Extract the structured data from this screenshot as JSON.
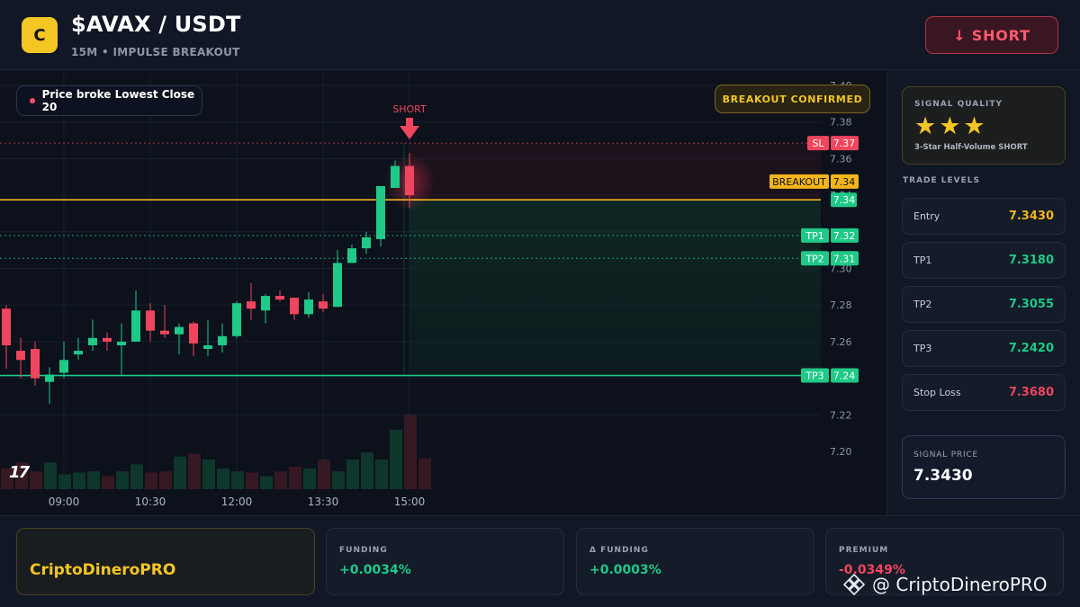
{
  "header": {
    "logo_letter": "C",
    "pair": "$AVAX / USDT",
    "subtitle": "15M • IMPULSE BREAKOUT",
    "action_button": "↓ SHORT"
  },
  "chart": {
    "price_note": "Price broke Lowest Close 20",
    "breakout_badge": "BREAKOUT CONFIRMED",
    "signal_marker": "SHORT",
    "tv_logo": "17"
  },
  "chart_data": {
    "type": "candlestick",
    "x_ticks": [
      "09:00",
      "10:30",
      "12:00",
      "13:30",
      "15:00"
    ],
    "y_ticks": [
      "7.40",
      "7.38",
      "7.36",
      "7.34",
      "7.32",
      "7.30",
      "7.28",
      "7.26",
      "7.22",
      "7.20"
    ],
    "ylim": [
      7.19,
      7.4
    ],
    "candles": [
      {
        "o": 7.278,
        "h": 7.28,
        "c": 7.258,
        "l": 7.245
      },
      {
        "o": 7.255,
        "h": 7.262,
        "c": 7.25,
        "l": 7.24
      },
      {
        "o": 7.256,
        "h": 7.26,
        "c": 7.24,
        "l": 7.236
      },
      {
        "o": 7.238,
        "h": 7.246,
        "c": 7.242,
        "l": 7.226
      },
      {
        "o": 7.243,
        "h": 7.26,
        "c": 7.25,
        "l": 7.24
      },
      {
        "o": 7.253,
        "h": 7.262,
        "c": 7.255,
        "l": 7.25
      },
      {
        "o": 7.258,
        "h": 7.272,
        "c": 7.262,
        "l": 7.255
      },
      {
        "o": 7.262,
        "h": 7.265,
        "c": 7.26,
        "l": 7.255
      },
      {
        "o": 7.258,
        "h": 7.27,
        "c": 7.26,
        "l": 7.242
      },
      {
        "o": 7.26,
        "h": 7.288,
        "c": 7.277,
        "l": 7.26
      },
      {
        "o": 7.277,
        "h": 7.281,
        "c": 7.266,
        "l": 7.26
      },
      {
        "o": 7.266,
        "h": 7.28,
        "c": 7.264,
        "l": 7.262
      },
      {
        "o": 7.264,
        "h": 7.27,
        "c": 7.268,
        "l": 7.253
      },
      {
        "o": 7.27,
        "h": 7.271,
        "c": 7.259,
        "l": 7.252
      },
      {
        "o": 7.256,
        "h": 7.272,
        "c": 7.258,
        "l": 7.252
      },
      {
        "o": 7.258,
        "h": 7.27,
        "c": 7.263,
        "l": 7.254
      },
      {
        "o": 7.263,
        "h": 7.282,
        "c": 7.281,
        "l": 7.262
      },
      {
        "o": 7.282,
        "h": 7.292,
        "c": 7.278,
        "l": 7.272
      },
      {
        "o": 7.277,
        "h": 7.286,
        "c": 7.285,
        "l": 7.27
      },
      {
        "o": 7.285,
        "h": 7.288,
        "c": 7.283,
        "l": 7.282
      },
      {
        "o": 7.284,
        "h": 7.284,
        "c": 7.275,
        "l": 7.272
      },
      {
        "o": 7.275,
        "h": 7.287,
        "c": 7.283,
        "l": 7.273
      },
      {
        "o": 7.282,
        "h": 7.286,
        "c": 7.278,
        "l": 7.276
      },
      {
        "o": 7.279,
        "h": 7.31,
        "c": 7.303,
        "l": 7.279
      },
      {
        "o": 7.303,
        "h": 7.313,
        "c": 7.311,
        "l": 7.303
      },
      {
        "o": 7.311,
        "h": 7.32,
        "c": 7.317,
        "l": 7.308
      },
      {
        "o": 7.316,
        "h": 7.337,
        "c": 7.345,
        "l": 7.312
      },
      {
        "o": 7.344,
        "h": 7.359,
        "c": 7.356,
        "l": 7.344
      },
      {
        "o": 7.356,
        "h": 7.363,
        "c": 7.34,
        "l": 7.333
      }
    ],
    "volume": [
      0.35,
      0.45,
      0.3,
      0.45,
      0.25,
      0.28,
      0.3,
      0.22,
      0.3,
      0.42,
      0.28,
      0.3,
      0.55,
      0.6,
      0.5,
      0.35,
      0.3,
      0.28,
      0.22,
      0.3,
      0.38,
      0.35,
      0.5,
      0.3,
      0.5,
      0.62,
      0.5,
      1.0,
      1.25,
      0.52
    ],
    "levels": [
      {
        "label": "SL",
        "value": "7.37",
        "color": "#f0455e"
      },
      {
        "label": "BREAKOUT",
        "value": "7.34",
        "color": "#f3b51d"
      },
      {
        "label": "TP1",
        "value": "7.32",
        "color": "#1fc987"
      },
      {
        "label": "TP2",
        "value": "7.31",
        "color": "#1fc987"
      },
      {
        "label": "TP3",
        "value": "7.24",
        "color": "#1fc987"
      }
    ],
    "current_price_tag": "7.34"
  },
  "panel": {
    "quality_label": "SIGNAL QUALITY",
    "stars": "★★★",
    "quality_desc": "3-Star Half-Volume SHORT",
    "levels_label": "TRADE LEVELS",
    "levels": [
      {
        "name": "Entry",
        "value": "7.3430",
        "color": "#f3b51d"
      },
      {
        "name": "TP1",
        "value": "7.3180",
        "color": "#1fc987"
      },
      {
        "name": "TP2",
        "value": "7.3055",
        "color": "#1fc987"
      },
      {
        "name": "TP3",
        "value": "7.2420",
        "color": "#1fc987"
      },
      {
        "name": "Stop Loss",
        "value": "7.3680",
        "color": "#f0455e"
      }
    ],
    "signal_price_label": "SIGNAL PRICE",
    "signal_price": "7.3430"
  },
  "bottom": {
    "brand": "CriptoDineroPRO",
    "stats": [
      {
        "label": "FUNDING",
        "value": "+0.0034%",
        "color": "#1fc987"
      },
      {
        "label": "Δ FUNDING",
        "value": "+0.0003%",
        "color": "#1fc987"
      },
      {
        "label": "PREMIUM",
        "value": "-0.0349%",
        "color": "#f0455e"
      }
    ],
    "watermark": "@ CriptoDineroPRO"
  }
}
